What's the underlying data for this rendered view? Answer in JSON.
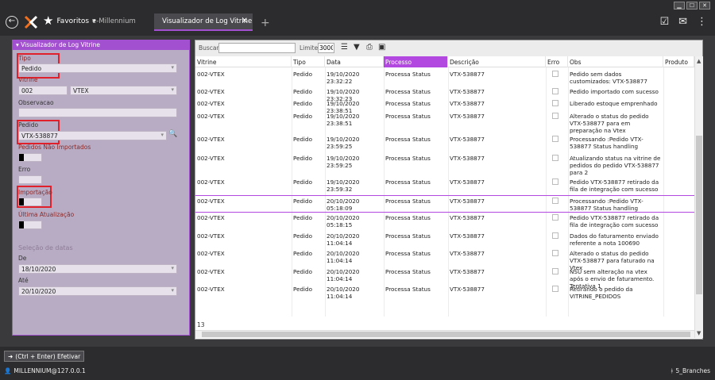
{
  "window": {
    "minimize": "▁",
    "maximize": "☐",
    "close": "✕"
  },
  "nav": {
    "favorites_label": "Favoritos",
    "favorites_chevron": "▾",
    "tab_inactive": "e-Millennium",
    "tab_active": "Visualizador de Log Vitrine"
  },
  "left": {
    "header": "Visualizador de Log Vitrine",
    "tipo_label": "Tipo",
    "tipo_value": "Pedido",
    "vitrine_label": "Vitrine",
    "vitrine_code": "002",
    "vitrine_name": "VTEX",
    "observacao_label": "Observacao",
    "pedido_label": "Pedido",
    "pedido_value": "VTX-538877",
    "nao_importados_label": "Pedidos Não Importados",
    "erro_label": "Erro",
    "importacao_label": "Importação",
    "ultima_label": "Última Atualização",
    "selecao_label": "Seleção de datas",
    "de_label": "De",
    "de_value": "18/10/2020",
    "ate_label": "Até",
    "ate_value": "20/10/2020"
  },
  "toolbar": {
    "search_label": "Buscar",
    "limit_label": "Limite",
    "limit_value": "3000"
  },
  "grid": {
    "headers": [
      "Vitrine",
      "Tipo",
      "Data",
      "Processo",
      "Descrição",
      "Erro",
      "Obs",
      "Produto"
    ],
    "rows": [
      {
        "vitrine": "002-VTEX",
        "tipo": "Pedido",
        "data": "19/10/2020 23:32:22",
        "processo": "Processa Status",
        "descricao": "VTX-538877",
        "obs": "Pedido sem dados customizados: VTX-538877"
      },
      {
        "vitrine": "002-VTEX",
        "tipo": "Pedido",
        "data": "19/10/2020 23:32:23",
        "processo": "Processa Status",
        "descricao": "VTX-538877",
        "obs": "Pedido importado com sucesso"
      },
      {
        "vitrine": "002-VTEX",
        "tipo": "Pedido",
        "data": "19/10/2020 23:38:51",
        "processo": "Processa Status",
        "descricao": "VTX-538877",
        "obs": "Liberado estoque emprenhado"
      },
      {
        "vitrine": "002-VTEX",
        "tipo": "Pedido",
        "data": "19/10/2020 23:38:51",
        "processo": "Processa Status",
        "descricao": "VTX-538877",
        "obs": "Alterado o status do pedido VTX-538877 para em preparação na Vtex"
      },
      {
        "vitrine": "002-VTEX",
        "tipo": "Pedido",
        "data": "19/10/2020 23:59:25",
        "processo": "Processa Status",
        "descricao": "VTX-538877",
        "obs": "Processando :Pedido VTX-538877 Status handling"
      },
      {
        "vitrine": "002-VTEX",
        "tipo": "Pedido",
        "data": "19/10/2020 23:59:25",
        "processo": "Processa Status",
        "descricao": "VTX-538877",
        "obs": "Atualizando status na vitrine de pedidos do pedido VTX-538877 para 2"
      },
      {
        "vitrine": "002-VTEX",
        "tipo": "Pedido",
        "data": "19/10/2020 23:59:32",
        "processo": "Processa Status",
        "descricao": "VTX-538877",
        "obs": "Pedido VTX-538877 retirado da fila de integração com sucesso"
      },
      {
        "vitrine": "002-VTEX",
        "tipo": "Pedido",
        "data": "20/10/2020 05:18:09",
        "processo": "Processa Status",
        "descricao": "VTX-538877",
        "obs": "Processando :Pedido VTX-538877 Status handling"
      },
      {
        "vitrine": "002-VTEX",
        "tipo": "Pedido",
        "data": "20/10/2020 05:18:15",
        "processo": "Processa Status",
        "descricao": "VTX-538877",
        "obs": "Pedido VTX-538877 retirado da fila de integração com sucesso"
      },
      {
        "vitrine": "002-VTEX",
        "tipo": "Pedido",
        "data": "20/10/2020 11:04:14",
        "processo": "Processa Status",
        "descricao": "VTX-538877",
        "obs": "Dados do faturamento enviado referente a nota 100690"
      },
      {
        "vitrine": "002-VTEX",
        "tipo": "Pedido",
        "data": "20/10/2020 11:04:14",
        "processo": "Processa Status",
        "descricao": "VTX-538877",
        "obs": "Alterado o status do pedido VTX-538877 para faturado na Vtex"
      },
      {
        "vitrine": "002-VTEX",
        "tipo": "Pedido",
        "data": "20/10/2020 11:04:14",
        "processo": "Processa Status",
        "descricao": "VTX-538877",
        "obs": "NSU sem alteração na vtex após o envio de faturamento. Tentativa 1"
      },
      {
        "vitrine": "002-VTEX",
        "tipo": "Pedido",
        "data": "20/10/2020 11:04:14",
        "processo": "Processa Status",
        "descricao": "VTX-538877",
        "obs": "Retirando o pedido da VITRINE_PEDIDOS"
      }
    ],
    "count": "13"
  },
  "bottom": {
    "efetivar": "(Ctrl + Enter) Efetivar",
    "user": "MILLENNIUM@127.0.0.1",
    "branch": "5_Branches"
  }
}
